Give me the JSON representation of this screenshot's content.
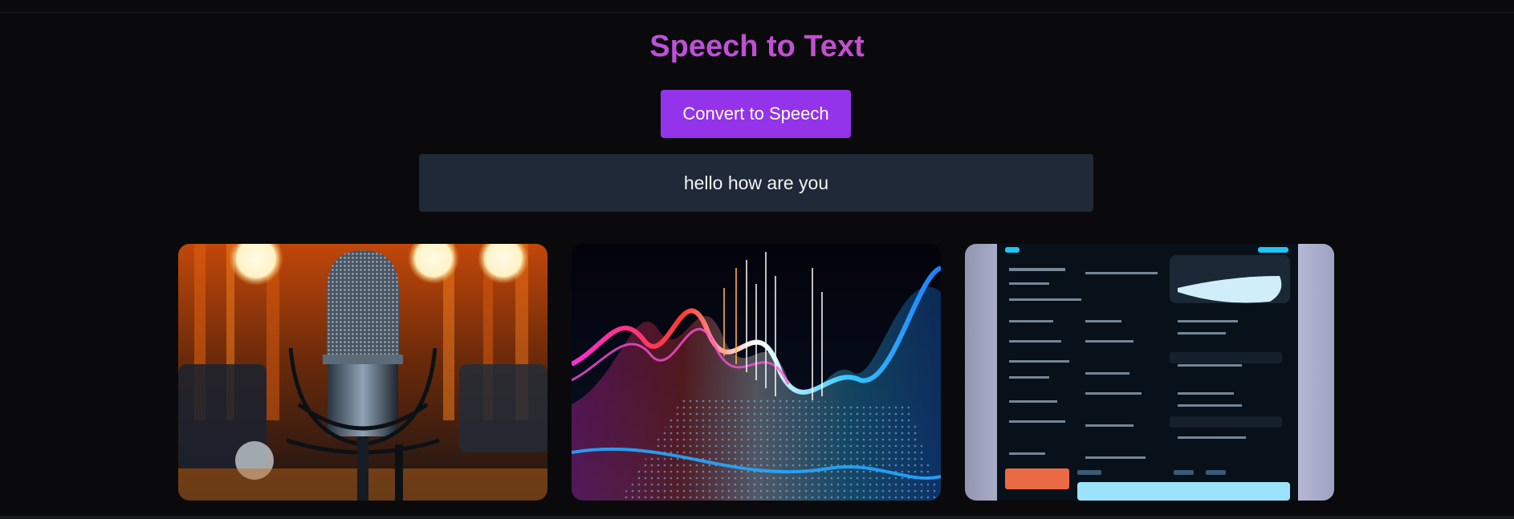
{
  "page": {
    "title": "Speech to Text"
  },
  "controls": {
    "convert_label": "Convert to Speech"
  },
  "result": {
    "text": "hello how are you"
  },
  "gallery": {
    "images": [
      {
        "icon": "studio-microphone-image"
      },
      {
        "icon": "sound-wave-image"
      },
      {
        "icon": "dashboard-tablet-image"
      }
    ]
  },
  "colors": {
    "background": "#0a0a0c",
    "button": "#9333ea",
    "result_box": "#1f2937",
    "title_gradient_start": "#a855f7",
    "title_gradient_end": "#ec4899"
  }
}
